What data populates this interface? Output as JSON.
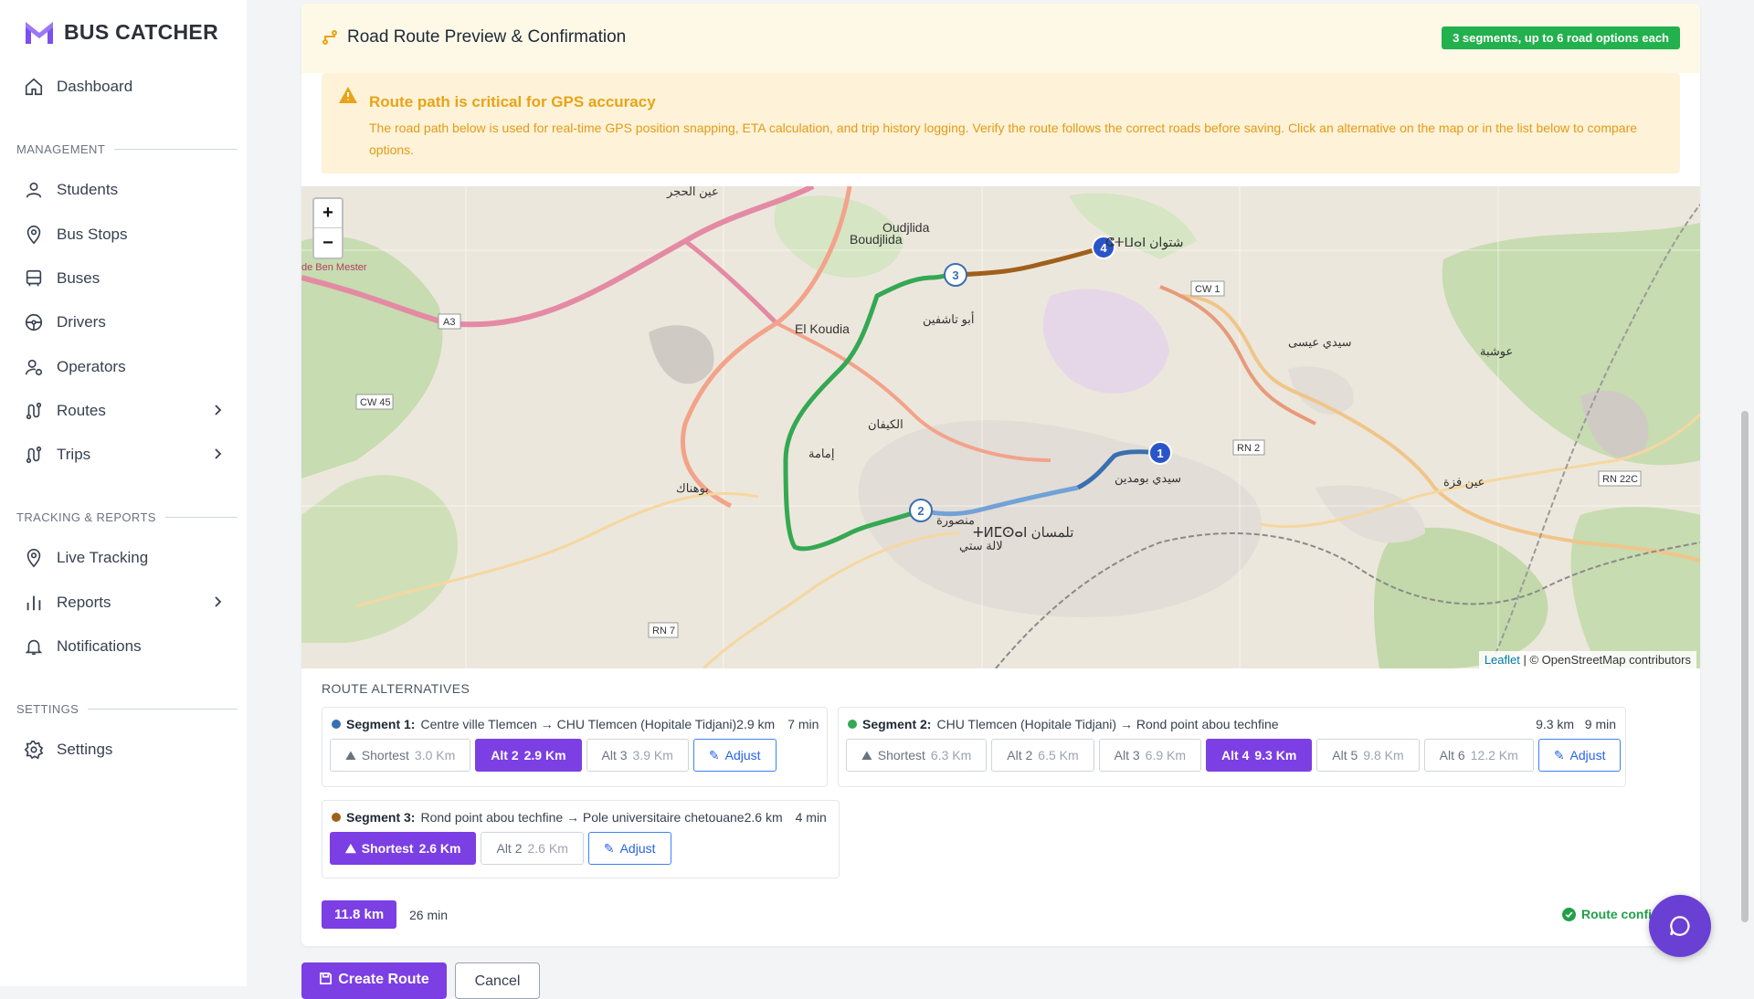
{
  "app": {
    "name": "BUS CATCHER"
  },
  "sidebar": {
    "dashboard": "Dashboard",
    "sections": {
      "management": "MANAGEMENT",
      "tracking": "TRACKING & REPORTS",
      "settings": "SETTINGS"
    },
    "items": {
      "students": "Students",
      "bus_stops": "Bus Stops",
      "buses": "Buses",
      "drivers": "Drivers",
      "operators": "Operators",
      "routes": "Routes",
      "trips": "Trips",
      "live_tracking": "Live Tracking",
      "reports": "Reports",
      "notifications": "Notifications",
      "settings": "Settings"
    }
  },
  "preview": {
    "title": "Road Route Preview & Confirmation",
    "badge": "3 segments, up to 6 road options each",
    "warning_title": "Route path is critical for GPS accuracy",
    "warning_text": "The road path below is used for real-time GPS position snapping, ETA calculation, and trip history logging. Verify the route follows the correct roads before saving. Click an alternative on the map or in the list below to compare options."
  },
  "map": {
    "zoom_in": "+",
    "zoom_out": "−",
    "markers": [
      "1",
      "2",
      "3",
      "4"
    ],
    "attribution_leaflet": "Leaflet",
    "attribution_rest": "| © OpenStreetMap contributors",
    "place_labels": {
      "boudjlida": "Boudjlida",
      "oudjlida": "Oudjlida",
      "el_koudia": "El Koudia",
      "tlemcen_ar": "ⵜⵍⵎⵙⴰⵏ تلمسان",
      "chetouane_ar": "ⵛⵜⵡⴰⵏ شتوان",
      "abou_tachfine": "أبو تاشفين",
      "el_kifane": "الكيفان",
      "imama": "إمامة",
      "sidi_boumediene": "سيدي بومدين",
      "mansourah": "منصورة",
      "bouhanak": "بوهناك",
      "mester": "de Ben Mester",
      "sidi_aissa": "سيدي عيسى",
      "ouchba": "عوشبة",
      "lalla_setti": "لالة ستي",
      "ain_fezza": "عين فزة",
      "ain_hadjar": "عين الحجر"
    },
    "road_labels": {
      "a3": "A3",
      "cw45": "CW 45",
      "rn2": "RN 2",
      "rn22c": "RN 22C",
      "rn7": "RN 7",
      "cw1": "CW 1"
    },
    "route_colors": {
      "seg1": "#3a6fb0",
      "seg2": "#34a853",
      "seg3": "#a0601c"
    }
  },
  "alternatives": {
    "label": "ROUTE ALTERNATIVES",
    "segments": [
      {
        "label": "Segment 1:",
        "path": "Centre ville Tlemcen → CHU Tlemcen (Hopitale Tidjani)2.9 km",
        "dist": "",
        "time": "7 min",
        "color": "#3a6fb0",
        "options": [
          {
            "name": "Shortest",
            "km": "3.0 Km",
            "selected": false
          },
          {
            "name": "Alt 2",
            "km": "2.9 Km",
            "selected": true
          },
          {
            "name": "Alt 3",
            "km": "3.9 Km",
            "selected": false
          }
        ],
        "adjust": "Adjust"
      },
      {
        "label": "Segment 2:",
        "path": "CHU Tlemcen (Hopitale Tidjani) → Rond point abou techfine",
        "dist": "9.3 km",
        "time": "9 min",
        "color": "#34a853",
        "options": [
          {
            "name": "Shortest",
            "km": "6.3 Km",
            "selected": false
          },
          {
            "name": "Alt 2",
            "km": "6.5 Km",
            "selected": false
          },
          {
            "name": "Alt 3",
            "km": "6.9 Km",
            "selected": false
          },
          {
            "name": "Alt 4",
            "km": "9.3 Km",
            "selected": true
          },
          {
            "name": "Alt 5",
            "km": "9.8 Km",
            "selected": false
          },
          {
            "name": "Alt 6",
            "km": "12.2 Km",
            "selected": false
          }
        ],
        "adjust": "Adjust"
      },
      {
        "label": "Segment 3:",
        "path": "Rond point abou techfine → Pole universitaire chetouane2.6 km",
        "dist": "",
        "time": "4 min",
        "color": "#a0601c",
        "options": [
          {
            "name": "Shortest",
            "km": "2.6 Km",
            "selected": true
          },
          {
            "name": "Alt 2",
            "km": "2.6 Km",
            "selected": false
          }
        ],
        "adjust": "Adjust"
      }
    ]
  },
  "summary": {
    "total_km": "11.8 km",
    "total_min": "26 min",
    "confirmed": "Route confir"
  },
  "actions": {
    "create": "Create Route",
    "cancel": "Cancel"
  },
  "colors": {
    "accent": "#7b3fe4",
    "success": "#22b14c",
    "warning": "#e8a317"
  }
}
